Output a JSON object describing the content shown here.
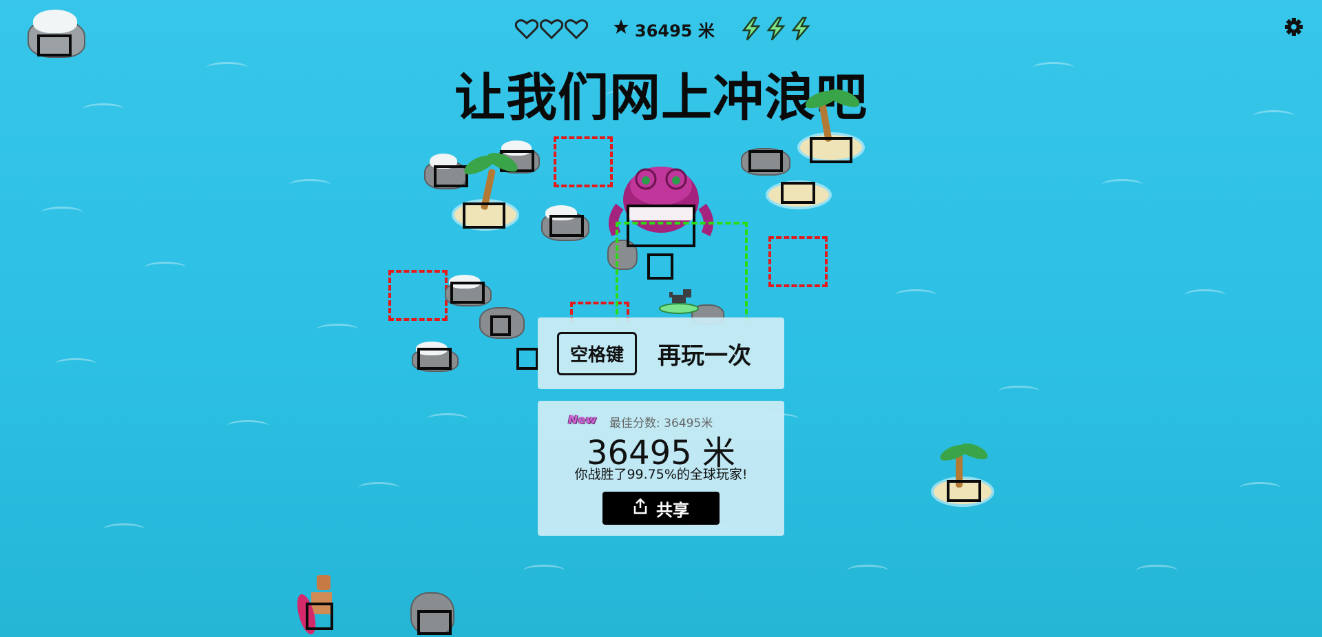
{
  "hud": {
    "lives": [
      "heart-empty",
      "heart-empty",
      "heart-empty"
    ],
    "score_text": "36495 米",
    "boosts": [
      "lightning-bolt",
      "lightning-bolt",
      "lightning-bolt"
    ],
    "settings_icon": "gear-icon"
  },
  "title": "让我们网上冲浪吧",
  "replay": {
    "key_label": "空格键",
    "action_label": "再玩一次"
  },
  "result": {
    "new_badge": "New",
    "best_score": "最佳分数: 36495米",
    "score": "36495 米",
    "percentile_text": "你战胜了99.75%的全球玩家!",
    "share_label": "共享",
    "share_icon": "share-icon"
  },
  "colors": {
    "water": "#2cc0e4",
    "detection_box": "#000000",
    "hazard_box": "#e51b1b",
    "player_box": "#2bdc12",
    "panel_bg": "#cbecf5",
    "share_button": "#000000",
    "new_badge": "#d064d6"
  }
}
